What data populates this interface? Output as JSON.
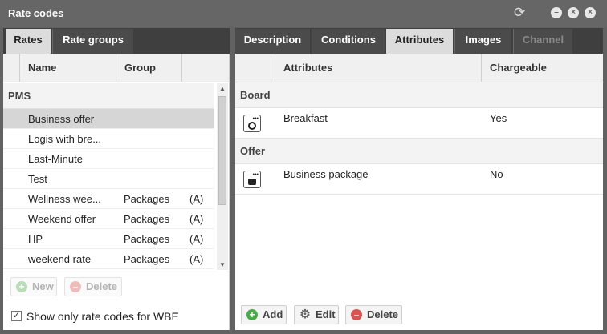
{
  "window": {
    "title": "Rate codes"
  },
  "left_tabs": [
    "Rates",
    "Rate groups"
  ],
  "right_tabs": [
    "Description",
    "Conditions",
    "Attributes",
    "Images",
    "Channel"
  ],
  "rates": {
    "columns": [
      "Name",
      "Group"
    ],
    "group_label": "PMS",
    "rows": [
      {
        "name": "Business offer",
        "group": "",
        "flag": ""
      },
      {
        "name": "Logis with bre...",
        "group": "",
        "flag": ""
      },
      {
        "name": "Last-Minute",
        "group": "",
        "flag": ""
      },
      {
        "name": "Test",
        "group": "",
        "flag": ""
      },
      {
        "name": "Wellness wee...",
        "group": "Packages",
        "flag": "(A)"
      },
      {
        "name": "Weekend offer",
        "group": "Packages",
        "flag": "(A)"
      },
      {
        "name": "HP",
        "group": "Packages",
        "flag": "(A)"
      },
      {
        "name": "weekend rate",
        "group": "Packages",
        "flag": "(A)"
      }
    ],
    "new_label": "New",
    "delete_label": "Delete",
    "checkbox_label": "Show only rate codes for WBE",
    "checkbox_checked": "✓"
  },
  "attributes": {
    "columns": [
      "Attributes",
      "Chargeable"
    ],
    "groups": [
      {
        "label": "Board",
        "items": [
          {
            "name": "Breakfast",
            "chargeable": "Yes",
            "icon": "breakfast-icon"
          }
        ]
      },
      {
        "label": "Offer",
        "items": [
          {
            "name": "Business package",
            "chargeable": "No",
            "icon": "business-package-icon"
          }
        ]
      }
    ],
    "add_label": "Add",
    "edit_label": "Edit",
    "delete_label": "Delete"
  }
}
